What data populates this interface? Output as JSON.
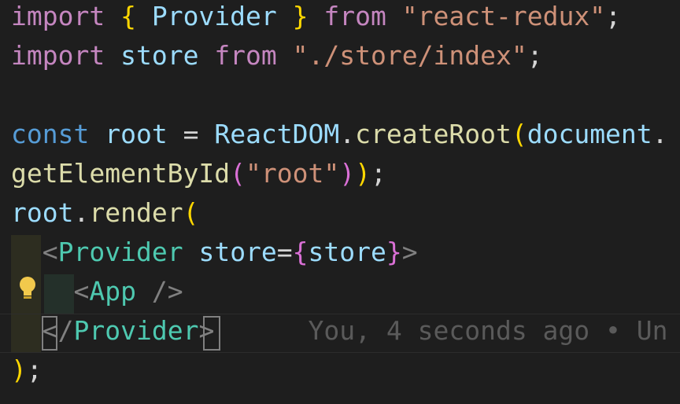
{
  "editor": {
    "lines": [
      {
        "tokens": [
          "import",
          "{",
          "Provider",
          "}",
          "from",
          "\"react-redux\"",
          ";"
        ]
      },
      {
        "tokens": [
          "import",
          "store",
          "from",
          "\"./store/index\"",
          ";"
        ]
      },
      {
        "tokens": []
      },
      {
        "tokens": [
          "const",
          "root",
          "=",
          "ReactDOM",
          ".",
          "createRoot",
          "(",
          "document",
          "."
        ]
      },
      {
        "tokens": [
          "getElementById",
          "(",
          "\"root\"",
          ")",
          ")",
          ";"
        ]
      },
      {
        "tokens": [
          "root",
          ".",
          "render",
          "("
        ]
      },
      {
        "tokens": [
          "<",
          "Provider",
          "store",
          "=",
          "{",
          "store",
          "}",
          ">"
        ]
      },
      {
        "tokens": [
          "<",
          "App",
          "/>"
        ]
      },
      {
        "tokens": [
          "</",
          "Provider",
          ">"
        ]
      },
      {
        "tokens": [
          ")",
          ";"
        ]
      }
    ],
    "blame": "You, 4 seconds ago • Un",
    "lightbulb_icon": "lightbulb-icon"
  }
}
